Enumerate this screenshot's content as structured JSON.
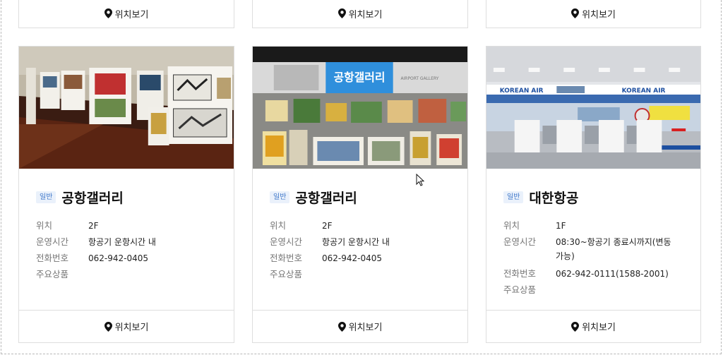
{
  "location_button_label": "위치보기",
  "labels": {
    "location": "위치",
    "hours": "운영시간",
    "phone": "전화번호",
    "products": "주요상품"
  },
  "cards": [
    {
      "badge": "일반",
      "name": "공항갤러리",
      "location": "2F",
      "hours": "항공기 운항시간 내",
      "phone": "062-942-0405",
      "products": ""
    },
    {
      "badge": "일반",
      "name": "공항갤러리",
      "location": "2F",
      "hours": "항공기 운항시간 내",
      "phone": "062-942-0405",
      "products": "",
      "photo_sign": "공항갤러리",
      "photo_subsign": "AIRPORT GALLERY"
    },
    {
      "badge": "일반",
      "name": "대한항공",
      "location": "1F",
      "hours": "08:30~항공기 종료시까지(변동가능)",
      "phone": "062-942-0111(1588-2001)",
      "products": "",
      "photo_sign": "KOREAN AIR"
    }
  ],
  "colors": {
    "badge_bg": "#eaf1fb",
    "badge_text": "#3f78c9",
    "border": "#dedede"
  }
}
